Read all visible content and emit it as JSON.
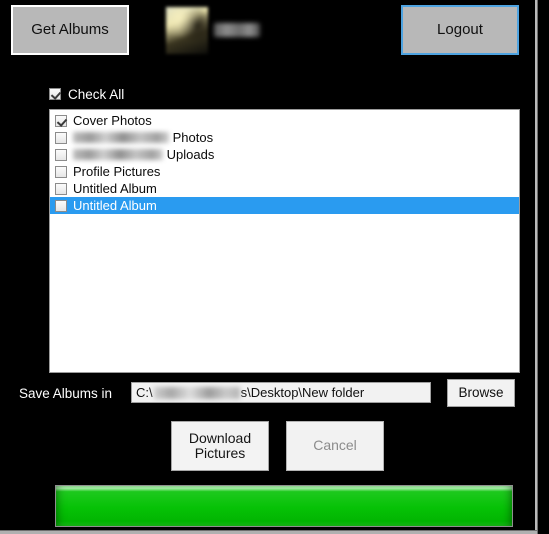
{
  "window": {
    "background_color": "#000000",
    "accent_color": "#2a9bf0",
    "progress_color": "#06c206"
  },
  "toolbar": {
    "get_albums_label": "Get Albums",
    "logout_label": "Logout",
    "profile": {
      "avatar_icon": "profile-photo-thumbnail",
      "name": "",
      "name_redacted": true
    }
  },
  "check_all": {
    "label": "Check All",
    "checked": true
  },
  "album_list": {
    "items": [
      {
        "label": "Cover Photos",
        "checked": true,
        "selected": false,
        "redacted_prefix": null
      },
      {
        "label": "Photos",
        "checked": false,
        "selected": false,
        "redacted_prefix": "redacted",
        "redacted_width": 96
      },
      {
        "label": "Uploads",
        "checked": false,
        "selected": false,
        "redacted_prefix": "redacted",
        "redacted_width": 90
      },
      {
        "label": "Profile Pictures",
        "checked": false,
        "selected": false,
        "redacted_prefix": null
      },
      {
        "label": "Untitled Album",
        "checked": false,
        "selected": false,
        "redacted_prefix": null
      },
      {
        "label": "Untitled Album",
        "checked": false,
        "selected": true,
        "redacted_prefix": null
      }
    ]
  },
  "save_row": {
    "label": "Save Albums in",
    "path_prefix": "C:\\",
    "path_suffix": "s\\Desktop\\New folder",
    "path_user_redacted": true,
    "browse_label": "Browse"
  },
  "actions": {
    "download_line1": "Download",
    "download_line2": "Pictures",
    "download_enabled": true,
    "cancel_label": "Cancel",
    "cancel_enabled": false
  },
  "progress": {
    "percent": 100,
    "value_text": ""
  }
}
